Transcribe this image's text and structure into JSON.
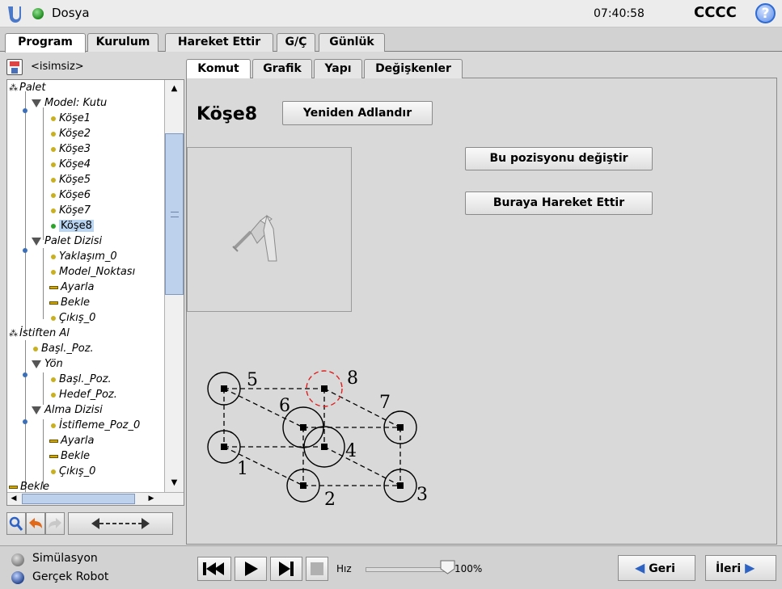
{
  "header": {
    "file_menu_label": "Dosya",
    "clock": "07:40:58",
    "robot_name": "CCCC",
    "help_glyph": "?"
  },
  "main_tabs": [
    {
      "label": "Program",
      "active": true
    },
    {
      "label": "Kurulum",
      "active": false
    },
    {
      "label": "Hareket Ettir",
      "active": false
    },
    {
      "label": "G/Ç",
      "active": false
    },
    {
      "label": "Günlük",
      "active": false
    }
  ],
  "left_panel": {
    "program_name": "<isimsiz>",
    "tree": [
      {
        "label": "Palet",
        "icon": "pallet-icon"
      },
      {
        "label": "Model: Kutu",
        "icon": "triangle-icon"
      },
      {
        "label": "Köşe1",
        "icon": "waypoint-icon"
      },
      {
        "label": "Köşe2",
        "icon": "waypoint-icon"
      },
      {
        "label": "Köşe3",
        "icon": "waypoint-icon"
      },
      {
        "label": "Köşe4",
        "icon": "waypoint-icon"
      },
      {
        "label": "Köşe5",
        "icon": "waypoint-icon"
      },
      {
        "label": "Köşe6",
        "icon": "waypoint-icon"
      },
      {
        "label": "Köşe7",
        "icon": "waypoint-icon"
      },
      {
        "label": "Köşe8",
        "icon": "waypoint-icon",
        "selected": true
      },
      {
        "label": "Palet Dizisi",
        "icon": "triangle-icon"
      },
      {
        "label": "Yaklaşım_0",
        "icon": "waypoint-icon"
      },
      {
        "label": "Model_Noktası",
        "icon": "waypoint-icon"
      },
      {
        "label": "Ayarla",
        "icon": "bar-icon"
      },
      {
        "label": "Bekle",
        "icon": "bar-icon"
      },
      {
        "label": "Çıkış_0",
        "icon": "waypoint-icon"
      },
      {
        "label": "İstiften Al",
        "icon": "pallet-icon"
      },
      {
        "label": "Başl._Poz.",
        "icon": "waypoint-icon"
      },
      {
        "label": "Yön",
        "icon": "triangle-icon"
      },
      {
        "label": "Başl._Poz.",
        "icon": "waypoint-icon"
      },
      {
        "label": "Hedef_Poz.",
        "icon": "waypoint-icon"
      },
      {
        "label": "Alma Dizisi",
        "icon": "triangle-icon"
      },
      {
        "label": "İstifleme_Poz_0",
        "icon": "waypoint-icon"
      },
      {
        "label": "Ayarla",
        "icon": "bar-icon"
      },
      {
        "label": "Bekle",
        "icon": "bar-icon"
      },
      {
        "label": "Çıkış_0",
        "icon": "waypoint-icon"
      },
      {
        "label": "Bekle",
        "icon": "bar-icon"
      }
    ]
  },
  "sub_tabs": [
    {
      "label": "Komut",
      "active": true
    },
    {
      "label": "Grafik",
      "active": false
    },
    {
      "label": "Yapı",
      "active": false
    },
    {
      "label": "Değişkenler",
      "active": false
    }
  ],
  "content": {
    "node_title": "Köşe8",
    "rename_button": "Yeniden Adlandır",
    "change_position_button": "Bu pozisyonu değiştir",
    "move_here_button": "Buraya Hareket Ettir",
    "pallet_labels": [
      "1",
      "2",
      "3",
      "4",
      "5",
      "6",
      "7",
      "8"
    ]
  },
  "bottom": {
    "simulation_label": "Simülasyon",
    "real_robot_label": "Gerçek Robot",
    "speed_label": "Hız",
    "speed_value": "100%",
    "speed_fraction": 1.0,
    "back_button": "Geri",
    "next_button": "İleri"
  },
  "colors": {
    "selection": "#b9d5f2",
    "accent_blue": "#2e63c4",
    "target_red": "#e02020"
  }
}
